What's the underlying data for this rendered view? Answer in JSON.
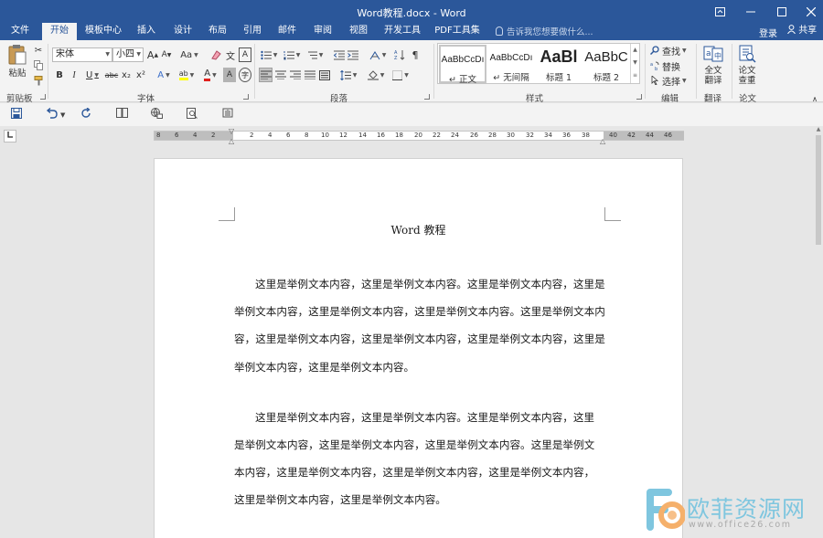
{
  "window": {
    "title": "Word教程.docx - Word"
  },
  "tabs": [
    {
      "label": "文件"
    },
    {
      "label": "开始"
    },
    {
      "label": "模板中心"
    },
    {
      "label": "插入"
    },
    {
      "label": "设计"
    },
    {
      "label": "布局"
    },
    {
      "label": "引用"
    },
    {
      "label": "邮件"
    },
    {
      "label": "审阅"
    },
    {
      "label": "视图"
    },
    {
      "label": "开发工具"
    },
    {
      "label": "PDF工具集"
    }
  ],
  "active_tab": "开始",
  "tell_me": {
    "placeholder": "告诉我您想要做什么..."
  },
  "account": {
    "login_label": "登录",
    "share_label": "共享"
  },
  "clipboard": {
    "paste_label": "粘贴",
    "group_label": "剪贴板"
  },
  "font": {
    "family": "宋体",
    "size": "小四",
    "group_label": "字体",
    "bold": "B",
    "italic": "I",
    "underline": "U",
    "strike": "abc",
    "subscript": "x₂",
    "superscript": "x²",
    "grow": "A",
    "shrink": "A",
    "case": "Aa",
    "phonetic": "文",
    "char_border": "A",
    "text_effect": "A",
    "highlight": "ab",
    "font_color": "A",
    "char_shading": "A",
    "enclose": "字"
  },
  "paragraph": {
    "group_label": "段落"
  },
  "styles": {
    "group_label": "样式",
    "items": [
      {
        "sample": "AaBbCcDı",
        "name": "↵ 正文"
      },
      {
        "sample": "AaBbCcDı",
        "name": "↵ 无间隔"
      },
      {
        "sample": "AaBl",
        "name": "标题 1"
      },
      {
        "sample": "AaBbC",
        "name": "标题 2"
      }
    ]
  },
  "editing": {
    "group_label": "编辑",
    "find": "查找",
    "replace": "替换",
    "select": "选择"
  },
  "translate": {
    "button_line1": "全文",
    "button_line2": "翻译",
    "group_label": "翻译"
  },
  "paper": {
    "button_line1": "论文",
    "button_line2": "查重",
    "group_label": "论文"
  },
  "ruler": {
    "numbers": [
      "8",
      "6",
      "4",
      "2",
      "",
      "2",
      "4",
      "6",
      "8",
      "10",
      "12",
      "14",
      "16",
      "18",
      "20",
      "22",
      "24",
      "26",
      "28",
      "30",
      "32",
      "34",
      "36",
      "38",
      "40",
      "42",
      "44",
      "46",
      "48"
    ]
  },
  "document": {
    "title": "Word 教程",
    "paragraphs": [
      {
        "lines": [
          "这里是举例文本内容，这里是举例文本内容。这里是举例文本内容，这里是",
          "举例文本内容，这里是举例文本内容，这里是举例文本内容。这里是举例文本内",
          "容，这里是举例文本内容，这里是举例文本内容，这里是举例文本内容，这里是",
          "举例文本内容，这里是举例文本内容。"
        ]
      },
      {
        "lines": [
          "这里是举例文本内容，这里是举例文本内容。这里是举例文本内容，这里",
          "是举例文本内容，这里是举例文本内容，这里是举例文本内容。这里是举例文",
          "本内容，这里是举例文本内容，这里是举例文本内容，这里是举例文本内容，",
          "这里是举例文本内容，这里是举例文本内容。"
        ]
      }
    ]
  },
  "watermark": {
    "brand": "欧菲资源网",
    "url": "www.office26.com"
  },
  "colors": {
    "accent": "#2b579a",
    "watermark": "#7fc6df"
  }
}
